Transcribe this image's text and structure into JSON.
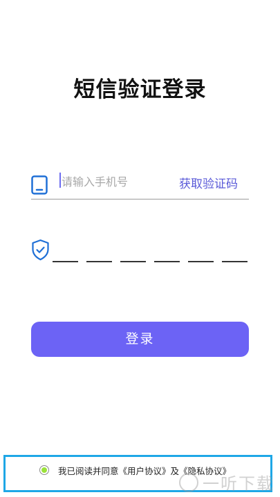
{
  "page": {
    "title": "短信验证登录"
  },
  "phone": {
    "placeholder": "请输入手机号",
    "get_code_label": "获取验证码"
  },
  "code": {
    "digit_count": 6
  },
  "login": {
    "label": "登录"
  },
  "agreement": {
    "prefix": "我已阅读并同意",
    "user_agreement": "《用户协议》",
    "conjunction": "及",
    "privacy_agreement": "《隐私协议》",
    "checked": true
  },
  "watermark": {
    "text": "一听下载"
  },
  "colors": {
    "accent": "#6c63f5",
    "link": "#5a5ad8",
    "icon": "#1e6fd6",
    "highlight_frame": "#1ea7e6",
    "radio_dot": "#9be23a"
  }
}
